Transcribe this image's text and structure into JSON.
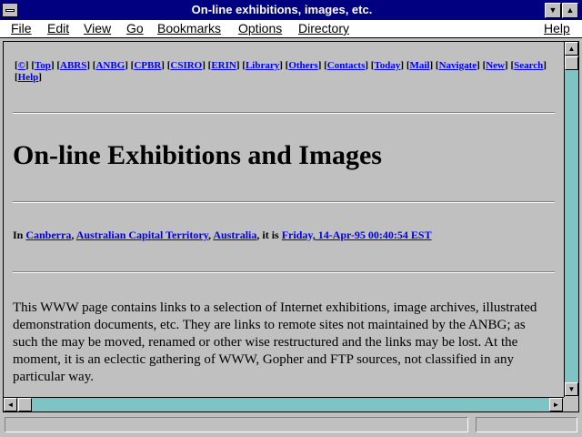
{
  "window": {
    "title": "On-line exhibitions, images, etc.",
    "minimize_glyph": "▼",
    "maximize_glyph": "▲"
  },
  "menubar": {
    "items": [
      {
        "label": "File"
      },
      {
        "label": "Edit"
      },
      {
        "label": "View"
      },
      {
        "label": "Go"
      },
      {
        "label": "Bookmarks"
      },
      {
        "label": "Options"
      },
      {
        "label": "Directory"
      },
      {
        "label": "Help"
      }
    ]
  },
  "page": {
    "nav_links": [
      "©",
      "Top",
      "ABRS",
      "ANBG",
      "CPBR",
      "CSIRO",
      "ERIN",
      "Library",
      "Others",
      "Contacts",
      "Today",
      "Mail",
      "Navigate",
      "New",
      "Search",
      "Help"
    ],
    "heading": "On-line Exhibitions and Images",
    "location": {
      "prefix": "In ",
      "city": "Canberra",
      "sep1": ", ",
      "territory": "Australian Capital Territory",
      "sep2": ", ",
      "country": "Australia",
      "middle": ", it is ",
      "datetime": "Friday, 14-Apr-95 00:40:54 EST"
    },
    "paragraph": "This WWW page contains links to a selection of Internet exhibitions, image archives, illustrated demonstration documents, etc. They are links to remote sites not maintained by the ANBG; as such the may be moved, renamed or other wise restructured and the links may be lost. At the moment, it is an eclectic gathering of WWW, Gopher and FTP sources, not classified in any particular way."
  },
  "scrollbars": {
    "up_glyph": "▲",
    "down_glyph": "▼",
    "left_glyph": "◄",
    "right_glyph": "►"
  },
  "colors": {
    "titlebar": "#000080",
    "link": "#0000ee",
    "scroll_track": "#7fc4c4",
    "window_bg": "#c0c0c0"
  }
}
